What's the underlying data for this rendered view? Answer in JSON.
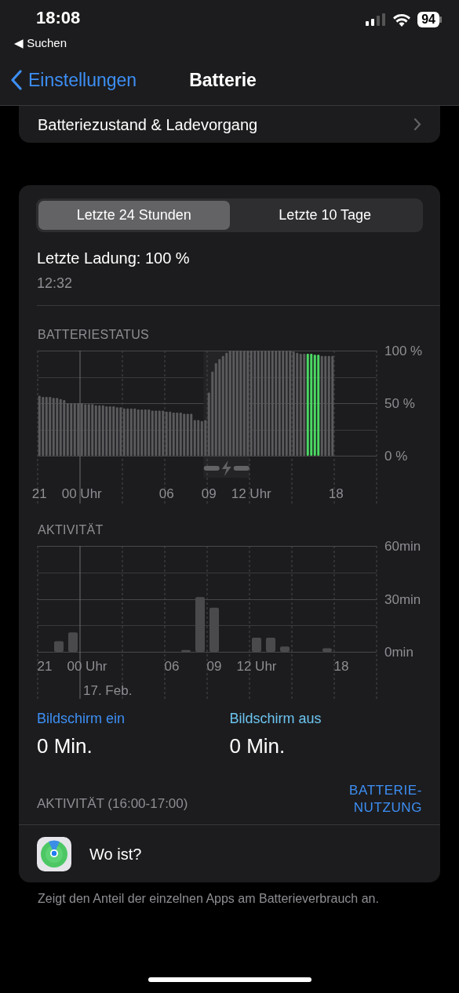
{
  "status_bar": {
    "time": "18:08",
    "back_app": "◀ Suchen",
    "battery": "94"
  },
  "nav": {
    "back": "Einstellungen",
    "title": "Batterie"
  },
  "health_row": {
    "label": "Batteriezustand & Ladevorgang"
  },
  "tabs": [
    {
      "label": "Letzte 24 Stunden",
      "selected": true
    },
    {
      "label": "Letzte 10 Tage",
      "selected": false
    }
  ],
  "last_charge": {
    "label": "Letzte Ladung: 100 %",
    "time": "12:32"
  },
  "battery_level": {
    "title": "BATTERIESTATUS",
    "chart_data": {
      "type": "bar",
      "ylim": [
        0,
        100
      ],
      "yticks": [
        {
          "value": 0,
          "label": "0 %"
        },
        {
          "value": 50,
          "label": "50 %"
        },
        {
          "value": 100,
          "label": "100 %"
        }
      ],
      "categories": [
        "21",
        null,
        null,
        null,
        null,
        null,
        null,
        null,
        null,
        null,
        null,
        null,
        "00 Uhr",
        null,
        null,
        null,
        null,
        null,
        null,
        null,
        null,
        null,
        null,
        null,
        null,
        null,
        null,
        null,
        null,
        null,
        null,
        null,
        null,
        null,
        null,
        null,
        "06",
        null,
        null,
        null,
        null,
        null,
        null,
        null,
        null,
        null,
        null,
        null,
        "09",
        null,
        null,
        null,
        null,
        null,
        null,
        null,
        null,
        null,
        null,
        null,
        "12 Uhr",
        null,
        null,
        null,
        null,
        null,
        null,
        null,
        null,
        null,
        null,
        null,
        null,
        null,
        null,
        null,
        null,
        null,
        null,
        null,
        null,
        null,
        null,
        null,
        "18",
        null,
        null,
        null,
        null,
        null,
        null,
        null,
        null,
        null,
        null,
        null
      ],
      "series": [
        {
          "color": "#5b5b5e",
          "values": [
            57,
            56,
            56,
            56,
            55,
            55,
            54,
            53,
            50,
            50,
            50,
            50,
            50,
            49,
            49,
            49,
            48,
            48,
            48,
            47,
            47,
            47,
            46,
            46,
            45,
            45,
            45,
            45,
            44,
            44,
            44,
            44,
            43,
            43,
            43,
            43,
            42,
            42,
            41,
            41,
            41,
            40,
            40,
            40,
            34,
            34,
            33,
            34,
            60,
            80,
            88,
            92,
            95,
            98,
            100,
            100,
            100,
            100,
            100,
            100,
            100,
            100,
            100,
            100,
            100,
            100,
            100,
            100,
            100,
            100,
            100,
            100,
            99,
            98,
            97,
            97,
            null,
            null,
            null,
            null,
            95,
            95,
            95,
            95,
            null,
            null,
            null,
            null,
            null,
            null,
            null,
            null,
            null,
            null,
            null,
            null
          ]
        },
        {
          "color": "#4cd964",
          "values": [
            null,
            null,
            null,
            null,
            null,
            null,
            null,
            null,
            null,
            null,
            null,
            null,
            null,
            null,
            null,
            null,
            null,
            null,
            null,
            null,
            null,
            null,
            null,
            null,
            null,
            null,
            null,
            null,
            null,
            null,
            null,
            null,
            null,
            null,
            null,
            null,
            null,
            null,
            null,
            null,
            null,
            null,
            null,
            null,
            null,
            null,
            null,
            null,
            null,
            null,
            null,
            null,
            null,
            null,
            null,
            null,
            null,
            null,
            null,
            null,
            null,
            null,
            null,
            null,
            null,
            null,
            null,
            null,
            null,
            null,
            null,
            null,
            null,
            null,
            null,
            null,
            97,
            97,
            96,
            96,
            null,
            null,
            null,
            null,
            null,
            null,
            null,
            null,
            null,
            null,
            null,
            null,
            null,
            null,
            null,
            null
          ]
        }
      ],
      "grid": true
    }
  },
  "activity": {
    "title": "AKTIVITÄT",
    "chart_data": {
      "type": "bar",
      "ylim": [
        0,
        60
      ],
      "yticks": [
        {
          "value": 0,
          "label": "0min"
        },
        {
          "value": 30,
          "label": "30min"
        },
        {
          "value": 60,
          "label": "60min"
        }
      ],
      "categories": [
        "21",
        null,
        null,
        "00 Uhr",
        null,
        null,
        null,
        null,
        null,
        "06",
        null,
        null,
        "09",
        null,
        null,
        "12 Uhr",
        null,
        null,
        null,
        null,
        null,
        "18",
        null,
        null
      ],
      "series": [
        {
          "color": "#4a4a4d",
          "values": [
            0,
            6,
            11,
            0,
            0,
            0,
            0,
            0,
            0,
            0,
            1,
            31,
            25,
            0,
            0,
            8,
            8,
            3,
            0,
            0,
            2,
            null,
            null,
            null
          ]
        }
      ],
      "grid": true,
      "annotations": [
        "17. Feb."
      ]
    }
  },
  "screen": [
    {
      "label": "Bildschirm ein",
      "value": "0 Min.",
      "color": "#3d8ff5"
    },
    {
      "label": "Bildschirm aus",
      "value": "0 Min.",
      "color": "#6cc4f0"
    }
  ],
  "range": {
    "label": "AKTIVITÄT (16:00-17:00)",
    "link": "BATTERIE-NUTZUNG"
  },
  "apps": [
    {
      "name": "Wo ist?"
    }
  ],
  "footer": "Zeigt den Anteil der einzelnen Apps am Batterieverbrauch an."
}
